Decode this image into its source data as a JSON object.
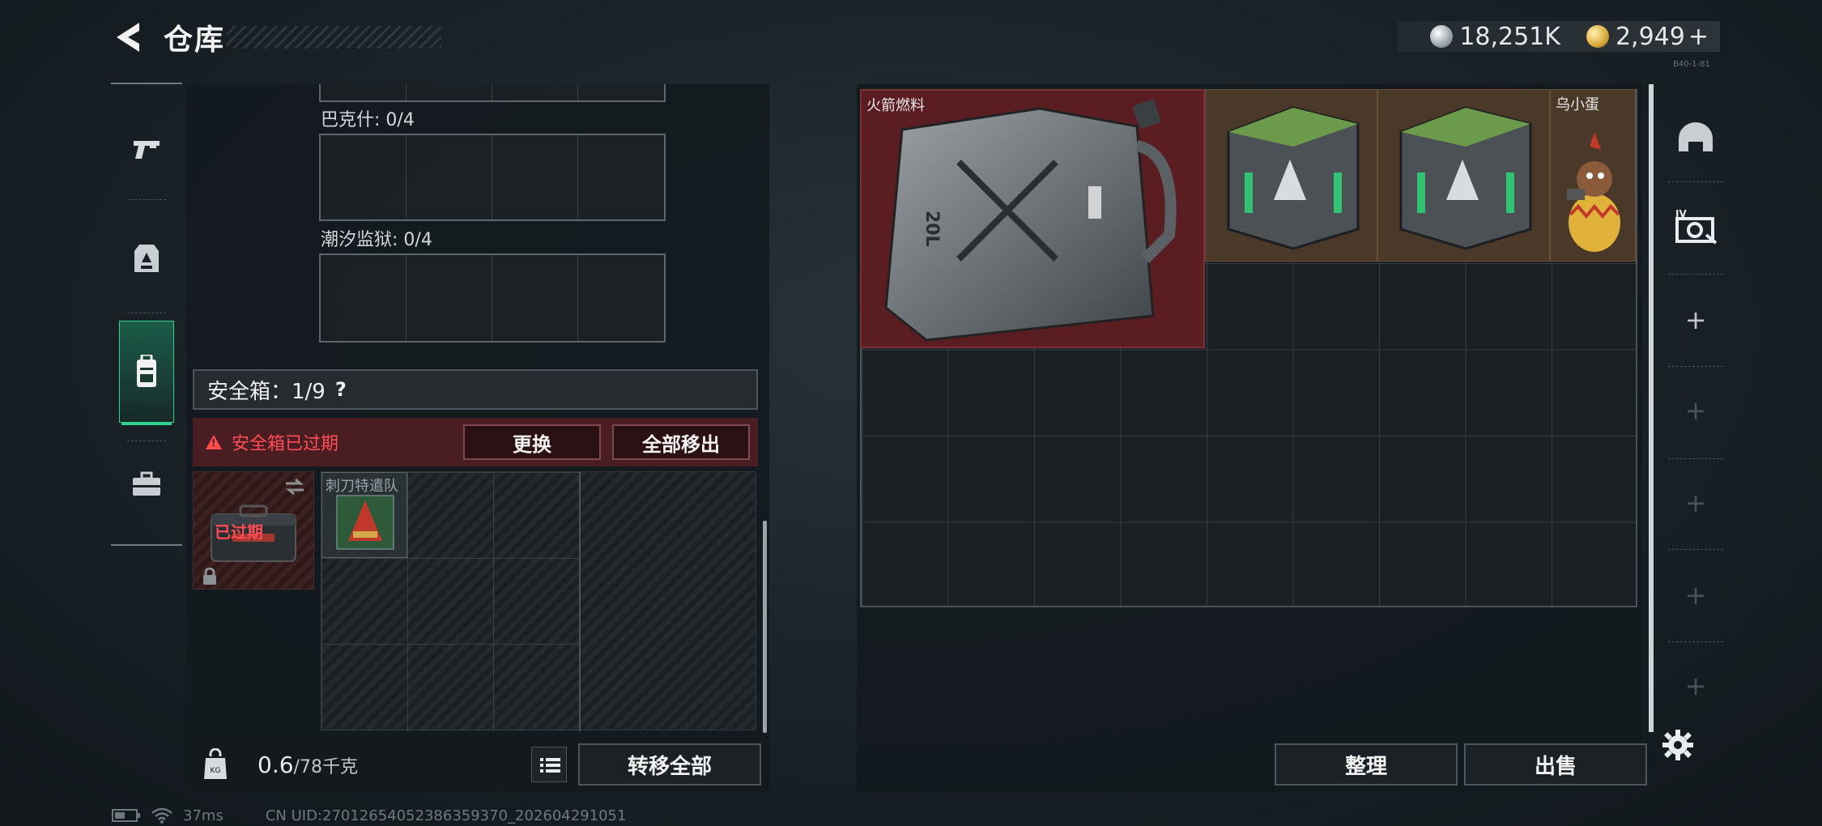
{
  "header": {
    "title": "仓库",
    "back_icon": "back-arrow-icon"
  },
  "currency": {
    "silver": "18,251K",
    "gold": "2,949",
    "add_label": "+"
  },
  "build_tag": "B40-1-81",
  "left_nav": {
    "items": [
      {
        "icon": "pistol-icon"
      },
      {
        "icon": "armor-vest-icon"
      },
      {
        "icon": "backpack-icon",
        "active": true
      },
      {
        "icon": "briefcase-icon"
      }
    ]
  },
  "key_storage": {
    "sections": [
      {
        "label": "巴克什: 0/4"
      },
      {
        "label": "潮汐监狱: 0/4"
      }
    ]
  },
  "safe_box": {
    "header": "安全箱：1/9",
    "help": "?",
    "expired_text": "安全箱已过期",
    "replace_button": "更换",
    "remove_all_button": "全部移出",
    "case_status": "已过期",
    "slot_item_label": "刺刀特遣队"
  },
  "footer": {
    "weight": "0.6",
    "weight_max": "/78千克",
    "transfer_all_button": "转移全部"
  },
  "stash": {
    "items": [
      {
        "label": "火箭燃料",
        "size": "4x3"
      },
      {
        "label": "",
        "size": "2x2"
      },
      {
        "label": "",
        "size": "2x2"
      },
      {
        "label": "乌小蛋",
        "size": "1x2"
      }
    ],
    "sort_button": "整理",
    "sell_button": "出售"
  },
  "right_rail": {
    "slots": [
      "helmet-icon",
      "camera-icon",
      "+",
      "+",
      "+",
      "+",
      "+"
    ]
  },
  "status": {
    "ping": "37ms",
    "uid": "CN UID:27012654052386359370_202604291051"
  },
  "colors": {
    "accent_green": "#2bd38e",
    "warning_red": "#ff4d55",
    "fuel_bg": "#5a1e22"
  }
}
